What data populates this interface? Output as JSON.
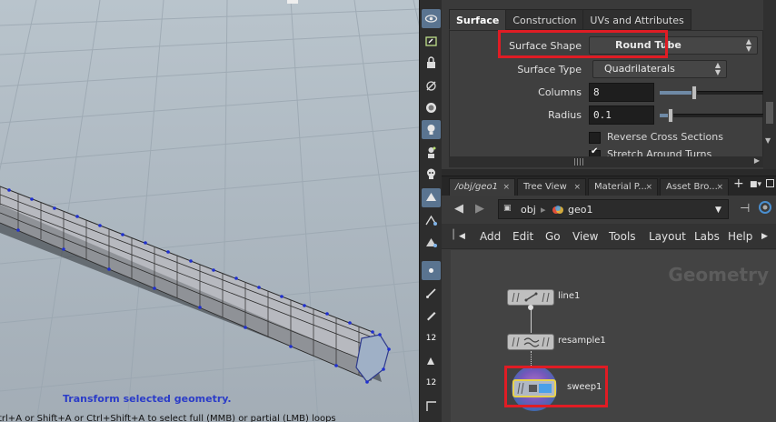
{
  "viewport": {
    "hint": "Transform selected geometry.",
    "status": "trl+A or Shift+A or Ctrl+Shift+A to select full (MMB) or partial (LMB) loops"
  },
  "toolbar": {
    "items": [
      "view-icon",
      "lasso-icon",
      "lock-icon",
      "snap-icon",
      "light-icon",
      "bulb-icon",
      "ghost-icon",
      "skull-icon",
      "display-icon",
      "wire-icon",
      "shade-icon",
      "point-icon",
      "brush-icon",
      "pen-icon",
      "numbers-icon",
      "arrow-icon",
      "num12-icon",
      "corner-icon"
    ],
    "label_12a": "12",
    "label_12b": "12"
  },
  "params": {
    "tabs": [
      "Surface",
      "Construction",
      "UVs and Attributes"
    ],
    "active_tab": "Surface",
    "surface_shape_label": "Surface Shape",
    "surface_shape_value": "Round Tube",
    "surface_type_label": "Surface Type",
    "surface_type_value": "Quadrilaterals",
    "columns_label": "Columns",
    "columns_value": "8",
    "columns_slider": 0.33,
    "radius_label": "Radius",
    "radius_value": "0.1",
    "radius_slider": 0.1,
    "reverse_label": "Reverse Cross Sections",
    "reverse_checked": false,
    "stretch_label": "Stretch Around Turns",
    "stretch_checked": true
  },
  "panetabs": {
    "tabs": [
      "/obj/geo1",
      "Tree View",
      "Material P...",
      "Asset Bro..."
    ],
    "close": "×",
    "plus": "+"
  },
  "pathbar": {
    "crumb1": "obj",
    "crumb2": "geo1"
  },
  "menubar": {
    "items": [
      "Add",
      "Edit",
      "Go",
      "View",
      "Tools",
      "Layout",
      "Labs",
      "Help"
    ]
  },
  "network": {
    "context_label": "Geometry",
    "nodes": [
      "line1",
      "resample1",
      "sweep1"
    ]
  },
  "colors": {
    "highlight": "#e01c24",
    "accent": "#5a7490",
    "hint_text": "#2b3cc8"
  }
}
